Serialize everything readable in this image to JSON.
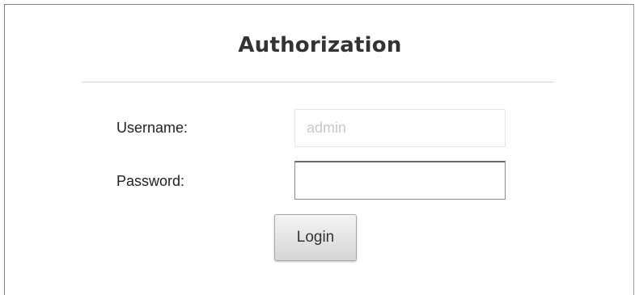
{
  "auth": {
    "title": "Authorization",
    "username_label": "Username:",
    "username_placeholder": "admin",
    "password_label": "Password:",
    "password_value": "",
    "login_label": "Login"
  }
}
